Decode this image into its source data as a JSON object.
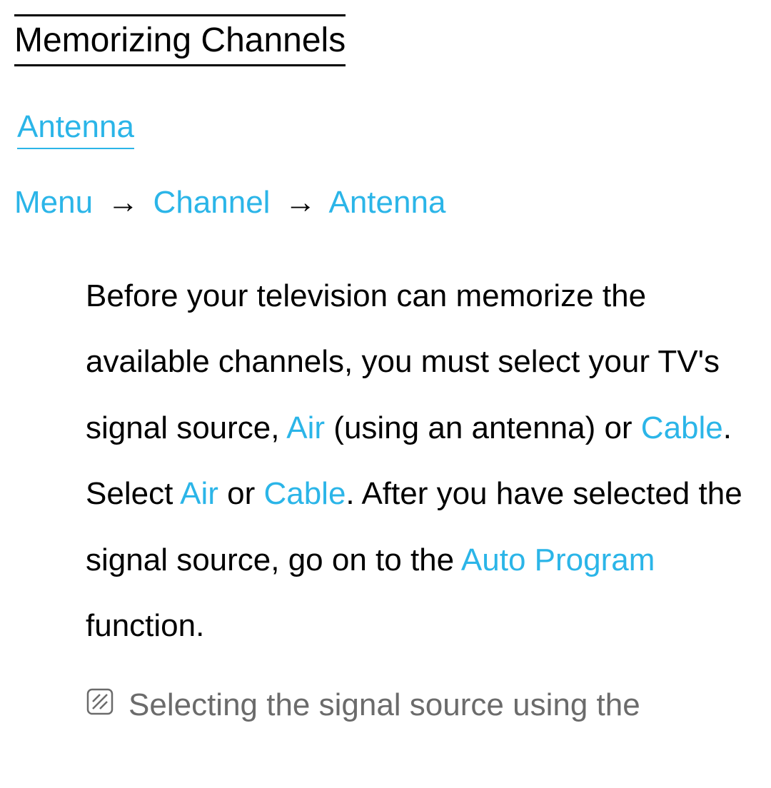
{
  "title": "Memorizing Channels",
  "subtitle": "Antenna",
  "breadcrumb": {
    "item1": "Menu",
    "arrow": "→",
    "item2": "Channel",
    "item3": "Antenna"
  },
  "body": {
    "text1": "Before your television can memorize the available channels, you must select your TV's signal source, ",
    "air1": "Air",
    "text2": " (using an antenna) or ",
    "cable1": "Cable",
    "text3": ". Select ",
    "air2": "Air",
    "text4": " or ",
    "cable2": "Cable",
    "text5": ". After you have selected the signal source, go on to the ",
    "autoprogram": "Auto Program",
    "text6": " function."
  },
  "note": {
    "text": "Selecting the signal source using the"
  }
}
